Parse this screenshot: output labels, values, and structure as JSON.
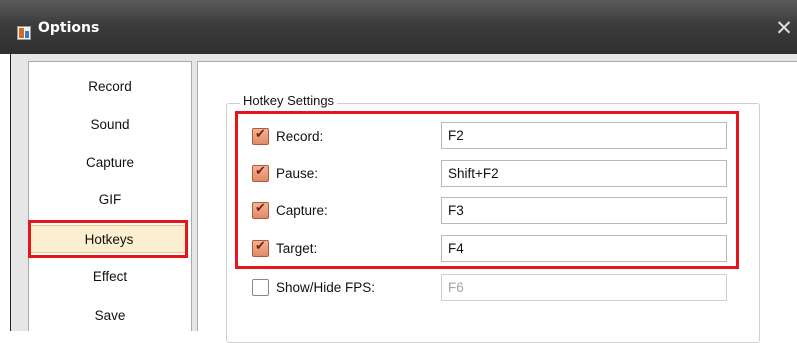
{
  "window": {
    "title": "Options",
    "close_glyph": "✕"
  },
  "sidebar": {
    "items": [
      {
        "label": "Record"
      },
      {
        "label": "Sound"
      },
      {
        "label": "Capture"
      },
      {
        "label": "GIF"
      },
      {
        "label": "Hotkeys",
        "selected": true
      },
      {
        "label": "Effect"
      },
      {
        "label": "Save"
      }
    ]
  },
  "hotkeys": {
    "group_title": "Hotkey Settings",
    "rows": [
      {
        "label": "Record:",
        "value": "F2",
        "checked": true
      },
      {
        "label": "Pause:",
        "value": "Shift+F2",
        "checked": true
      },
      {
        "label": "Capture:",
        "value": "F3",
        "checked": true
      },
      {
        "label": "Target:",
        "value": "F4",
        "checked": true
      },
      {
        "label": "Show/Hide FPS:",
        "value": "F6",
        "checked": false
      }
    ]
  },
  "colors": {
    "highlight": "#e4151b",
    "selected_bg": "#fbefd0",
    "checkbox_checked": "#e08a68"
  }
}
